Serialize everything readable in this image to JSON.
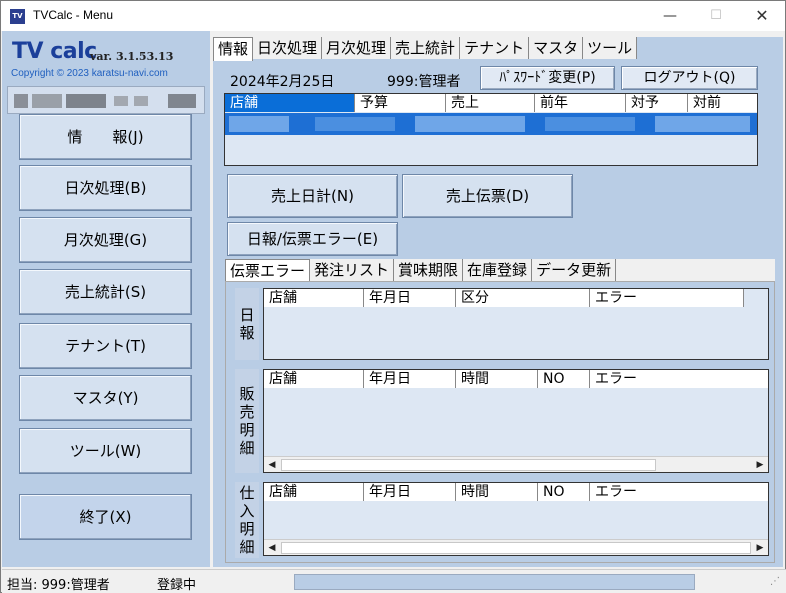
{
  "window": {
    "title": "TVCalc - Menu",
    "icon_text": "TV",
    "controls": {
      "minimize": "—",
      "maximize": "☐",
      "close": "✕"
    }
  },
  "sidebar": {
    "logo": "TV calc",
    "version": "var. 3.1.53.13",
    "copyright": "Copyright © 2023 karatsu-navi.com",
    "buttons": [
      {
        "label": "情　　報(J)"
      },
      {
        "label": "日次処理(B)"
      },
      {
        "label": "月次処理(G)"
      },
      {
        "label": "売上統計(S)"
      },
      {
        "label": "テナント(T)"
      },
      {
        "label": "マスタ(Y)"
      },
      {
        "label": "ツール(W)"
      }
    ],
    "exit_label": "終了(X)"
  },
  "main": {
    "tabs": [
      "情報",
      "日次処理",
      "月次処理",
      "売上統計",
      "テナント",
      "マスタ",
      "ツール"
    ],
    "active_tab": "情報",
    "date": "2024年2月25日",
    "user": "999:管理者",
    "password_button": "ﾊﾟｽﾜｰﾄﾞ変更(P)",
    "logout_button": "ログアウト(Q)",
    "sales_grid": {
      "columns": [
        "店舗",
        "予算",
        "売上",
        "前年",
        "対予",
        "対前"
      ]
    },
    "buttons": {
      "daily_sales": "売上日計(N)",
      "sales_slip": "売上伝票(D)",
      "error": "日報/伝票エラー(E)"
    },
    "subtabs": [
      "伝票エラー",
      "発注リスト",
      "賞味期限",
      "在庫登録",
      "データ更新"
    ],
    "active_subtab": "伝票エラー",
    "sections": [
      {
        "label": "日\n報",
        "columns": [
          "店舗",
          "年月日",
          "区分",
          "エラー"
        ]
      },
      {
        "label": "販\n売\n明\n細",
        "columns": [
          "店舗",
          "年月日",
          "時間",
          "NO",
          "エラー"
        ]
      },
      {
        "label": "仕\n入\n明\n細",
        "columns": [
          "店舗",
          "年月日",
          "時間",
          "NO",
          "エラー"
        ]
      }
    ],
    "scroll": {
      "left": "◀",
      "right": "▶"
    }
  },
  "status": {
    "user": "担当: 999:管理者",
    "mode": "登録中",
    "grip": "⋰"
  }
}
